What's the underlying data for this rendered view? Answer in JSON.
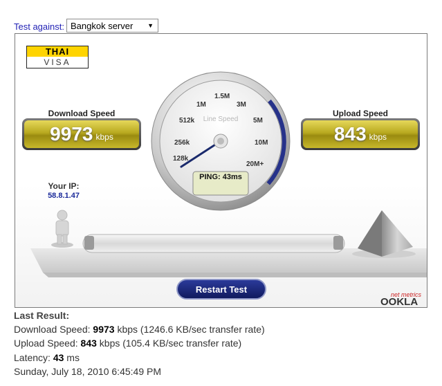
{
  "selector": {
    "label": "Test against:",
    "value": "Bangkok server"
  },
  "logo": {
    "top": "THAI",
    "bottom": "VISA"
  },
  "download": {
    "title": "Download Speed",
    "value": "9973",
    "unit": "kbps"
  },
  "upload": {
    "title": "Upload Speed",
    "value": "843",
    "unit": "kbps"
  },
  "ip": {
    "label": "Your IP:",
    "value": "58.8.1.47"
  },
  "gauge": {
    "center_label": "Line Speed",
    "ticks": [
      "128k",
      "256k",
      "512k",
      "1M",
      "1.5M",
      "3M",
      "5M",
      "10M",
      "20M+"
    ],
    "needle_value": "9973 kbps",
    "ping": "PING: 43ms"
  },
  "restart_button": "Restart Test",
  "brand": {
    "small": "net metrics",
    "name": "OOKLA"
  },
  "last_result": {
    "title": "Last Result:",
    "download_prefix": "Download Speed: ",
    "download_value": "9973",
    "download_suffix": " kbps (1246.6 KB/sec transfer rate)",
    "upload_prefix": "Upload Speed: ",
    "upload_value": "843",
    "upload_suffix": " kbps (105.4 KB/sec transfer rate)",
    "latency_prefix": "Latency: ",
    "latency_value": "43",
    "latency_suffix": " ms",
    "date": "Sunday, July 18, 2010 6:45:49 PM"
  },
  "colors": {
    "label_blue": "#1f1fb4",
    "gold": "#b8a91f",
    "navy": "#1a2a6c",
    "ookla_red": "#cc2222"
  }
}
